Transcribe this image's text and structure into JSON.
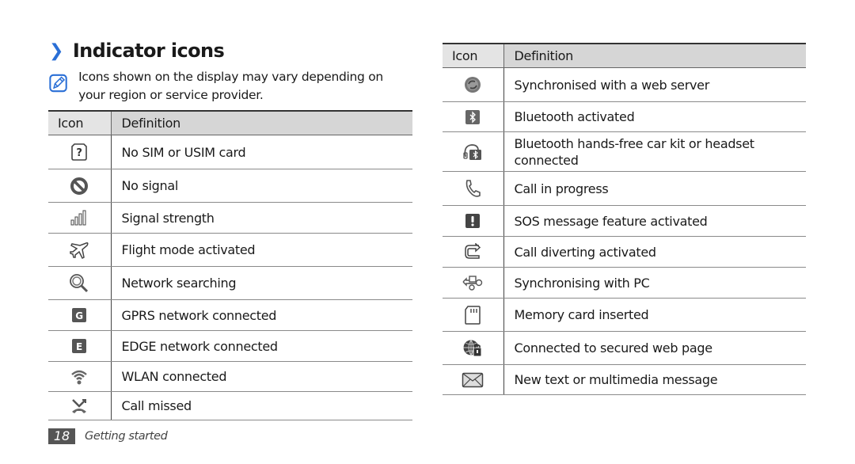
{
  "heading": {
    "chevron": "❯",
    "title": "Indicator icons"
  },
  "note": {
    "icon": "note-pencil-icon",
    "text": "Icons shown on the display may vary depending on your region or service provider."
  },
  "table_headers": {
    "icon": "Icon",
    "definition": "Definition"
  },
  "left_table": [
    {
      "icon": "no-sim-icon",
      "definition": "No SIM or USIM card"
    },
    {
      "icon": "no-signal-icon",
      "definition": "No signal"
    },
    {
      "icon": "signal-strength-icon",
      "definition": "Signal strength"
    },
    {
      "icon": "flight-mode-icon",
      "definition": "Flight mode activated"
    },
    {
      "icon": "network-searching-icon",
      "definition": "Network searching"
    },
    {
      "icon": "gprs-icon",
      "definition": "GPRS network connected"
    },
    {
      "icon": "edge-icon",
      "definition": "EDGE network connected"
    },
    {
      "icon": "wlan-icon",
      "definition": "WLAN connected"
    },
    {
      "icon": "call-missed-icon",
      "definition": "Call missed"
    }
  ],
  "right_table": [
    {
      "icon": "web-sync-icon",
      "definition": "Synchronised with a web server"
    },
    {
      "icon": "bluetooth-icon",
      "definition": "Bluetooth activated"
    },
    {
      "icon": "bluetooth-headset-icon",
      "definition": "Bluetooth hands-free car kit or headset connected"
    },
    {
      "icon": "call-progress-icon",
      "definition": "Call in progress"
    },
    {
      "icon": "sos-icon",
      "definition": "SOS message feature activated"
    },
    {
      "icon": "call-divert-icon",
      "definition": "Call diverting activated"
    },
    {
      "icon": "pc-sync-icon",
      "definition": "Synchronising with PC"
    },
    {
      "icon": "memory-card-icon",
      "definition": "Memory card inserted"
    },
    {
      "icon": "secure-web-icon",
      "definition": "Connected to secured web page"
    },
    {
      "icon": "new-message-icon",
      "definition": "New text or multimedia message"
    }
  ],
  "footer": {
    "page_number": "18",
    "section": "Getting started"
  },
  "colors": {
    "accent": "#2a6fd6",
    "header_bg": "#d6d6d6",
    "page_badge": "#555555"
  }
}
